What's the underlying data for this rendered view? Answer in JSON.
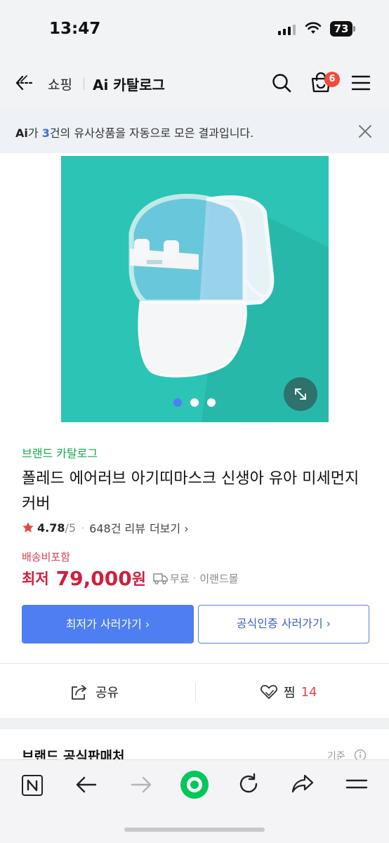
{
  "status_bar": {
    "time": "13:47",
    "battery": "73",
    "icons": [
      "cellular-signal-icon",
      "wifi-icon",
      "battery-icon"
    ]
  },
  "header": {
    "back_icon": "back-arrow-icon",
    "shop_label": "쇼핑",
    "title": "Ai 카탈로그",
    "cart_badge": "6",
    "icons": [
      "search-icon",
      "cart-icon",
      "menu-icon"
    ]
  },
  "notice": {
    "ai": "Ai",
    "part1": "가 ",
    "count": "3",
    "part2": "건의 유사상품을 자동으로 모은 결과입니다.",
    "close_icon": "close-icon"
  },
  "gallery": {
    "image_alt": "white transparent infant face mask",
    "dots_total": 3,
    "active_dot": 1,
    "zoom_icon": "expand-icon"
  },
  "product": {
    "brand_catalog": "브랜드 카탈로그",
    "title": "폴레드 에어러브 아기띠마스크 신생아 유아 미세먼지 커버",
    "rating": "4.78",
    "rating_total": "/5",
    "review_count": "648건 리뷰",
    "review_more": "더보기 ›",
    "shipping_label": "배송비포함",
    "price_prefix": "최저",
    "price": "79,000",
    "price_unit": "원",
    "ship_free": "무료",
    "seller": "이랜드몰"
  },
  "buttons": {
    "lowest": "최저가 사러가기 ›",
    "official": "공식인증 사러가기 ›"
  },
  "actions": {
    "share": "공유",
    "wish": "찜",
    "wish_count": "14"
  },
  "section": {
    "title": "브랜드 공식판매처",
    "basis": "기준"
  },
  "toolbar": {
    "items": [
      "naver-n-icon",
      "back-icon",
      "forward-icon",
      "home-green-icon",
      "refresh-icon",
      "share-icon",
      "more-icon"
    ]
  },
  "colors": {
    "accent_blue": "#4e7ef1",
    "price_red": "#d01f3c",
    "brand_green": "#14a84a",
    "image_bg": "#2cc4b4"
  }
}
